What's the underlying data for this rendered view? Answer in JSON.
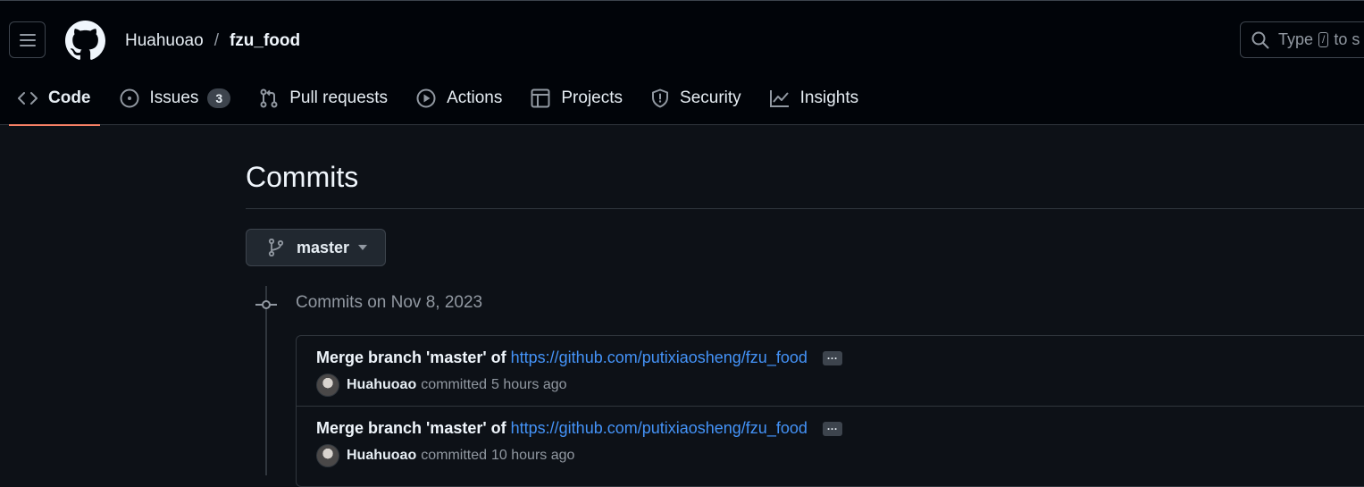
{
  "header": {
    "owner": "Huahuoao",
    "separator": "/",
    "repo": "fzu_food",
    "search_placeholder_prefix": "Type",
    "search_key": "/",
    "search_placeholder_suffix": "to s"
  },
  "tabs": [
    {
      "label": "Code",
      "icon": "code-icon",
      "active": true
    },
    {
      "label": "Issues",
      "icon": "issue-icon",
      "counter": "3"
    },
    {
      "label": "Pull requests",
      "icon": "pull-request-icon"
    },
    {
      "label": "Actions",
      "icon": "play-icon"
    },
    {
      "label": "Projects",
      "icon": "table-icon"
    },
    {
      "label": "Security",
      "icon": "shield-icon"
    },
    {
      "label": "Insights",
      "icon": "graph-icon"
    }
  ],
  "main": {
    "title": "Commits",
    "branch": "master",
    "group_title": "Commits on Nov 8, 2023",
    "commits": [
      {
        "message": "Merge branch 'master' of",
        "link": "https://github.com/putixiaosheng/fzu_food",
        "ellipsis": "···",
        "author": "Huahuoao",
        "action": "committed",
        "time": "5 hours ago"
      },
      {
        "message": "Merge branch 'master' of",
        "link": "https://github.com/putixiaosheng/fzu_food",
        "ellipsis": "···",
        "author": "Huahuoao",
        "action": "committed",
        "time": "10 hours ago"
      }
    ]
  },
  "colors": {
    "background": "#0d1117",
    "header_bg": "#010409",
    "border": "#30363d",
    "link": "#4493f8",
    "active_tab_underline": "#f78166"
  }
}
